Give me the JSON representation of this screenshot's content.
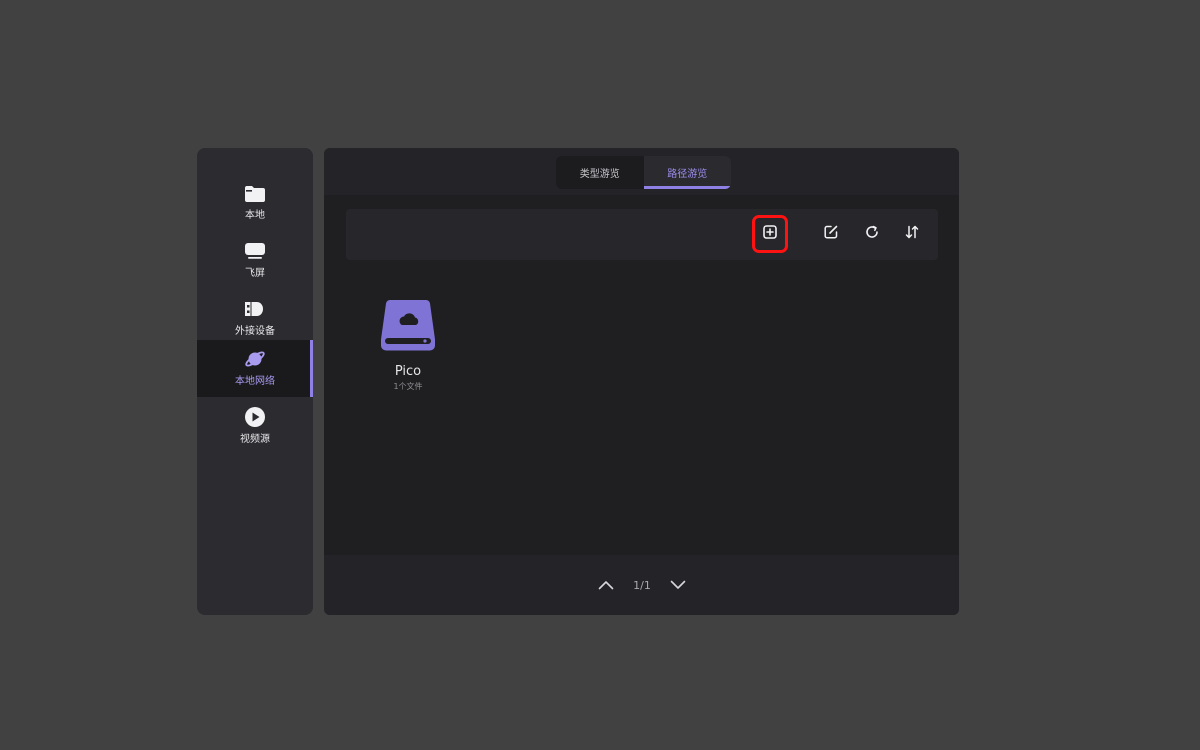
{
  "sidebar": {
    "items": [
      {
        "label": "本地",
        "icon": "folder-icon",
        "active": false
      },
      {
        "label": "飞屏",
        "icon": "monitor-icon",
        "active": false
      },
      {
        "label": "外接设备",
        "icon": "usb-drive-icon",
        "active": false
      },
      {
        "label": "本地网络",
        "icon": "planet-icon",
        "active": true
      },
      {
        "label": "视频源",
        "icon": "play-circle-icon",
        "active": false
      }
    ]
  },
  "tabs": [
    {
      "label": "类型游览",
      "active": false
    },
    {
      "label": "路径游览",
      "active": true
    }
  ],
  "toolbar": {
    "buttons": [
      {
        "icon": "add-square-icon",
        "highlighted": true
      },
      {
        "icon": "edit-icon",
        "highlighted": false
      },
      {
        "icon": "refresh-icon",
        "highlighted": false
      },
      {
        "icon": "sort-icon",
        "highlighted": false
      }
    ]
  },
  "files": [
    {
      "name": "Pico",
      "count": "1个文件",
      "icon": "network-drive-icon"
    }
  ],
  "pager": {
    "text": "1/1"
  },
  "colors": {
    "background": "#414141",
    "accent": "#8f80e6",
    "highlight": "#ff1212",
    "drive": "#7f74d6"
  }
}
